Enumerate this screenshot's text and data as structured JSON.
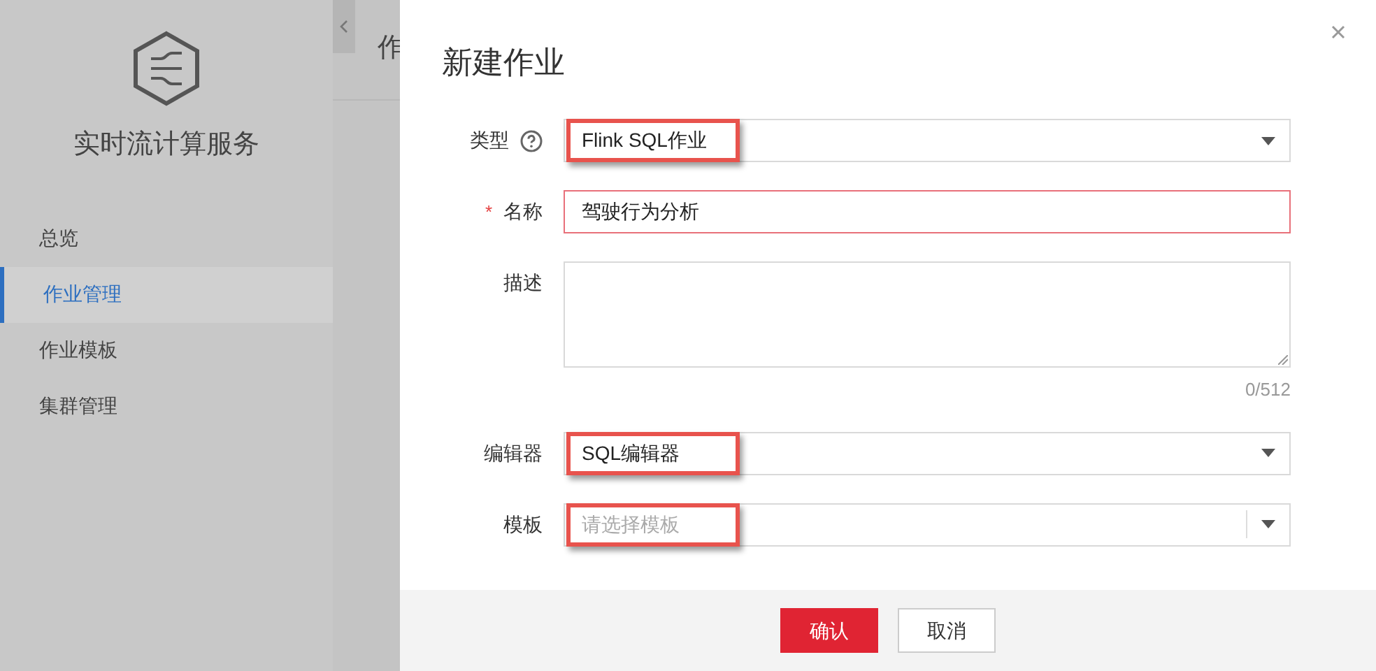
{
  "sidebar": {
    "title": "实时流计算服务",
    "items": [
      {
        "label": "总览",
        "selected": false
      },
      {
        "label": "作业管理",
        "selected": true
      },
      {
        "label": "作业模板",
        "selected": false
      },
      {
        "label": "集群管理",
        "selected": false
      }
    ]
  },
  "background_page": {
    "title": "作"
  },
  "dialog": {
    "title": "新建作业",
    "fields": [
      {
        "kind": "select",
        "label": "类型",
        "help": true,
        "value": "Flink SQL作业",
        "highlighted": true
      },
      {
        "kind": "text",
        "label": "名称",
        "required_mark": "*",
        "value": "驾驶行为分析"
      },
      {
        "kind": "textarea",
        "label": "描述",
        "counter": "0/512"
      },
      {
        "kind": "select",
        "label": "编辑器",
        "value": "SQL编辑器",
        "highlighted": true
      },
      {
        "kind": "combo",
        "label": "模板",
        "placeholder": "请选择模板",
        "highlighted": true
      }
    ],
    "buttons": [
      {
        "label": "确认",
        "kind": "primary"
      },
      {
        "label": "取消",
        "kind": "secondary"
      }
    ]
  }
}
